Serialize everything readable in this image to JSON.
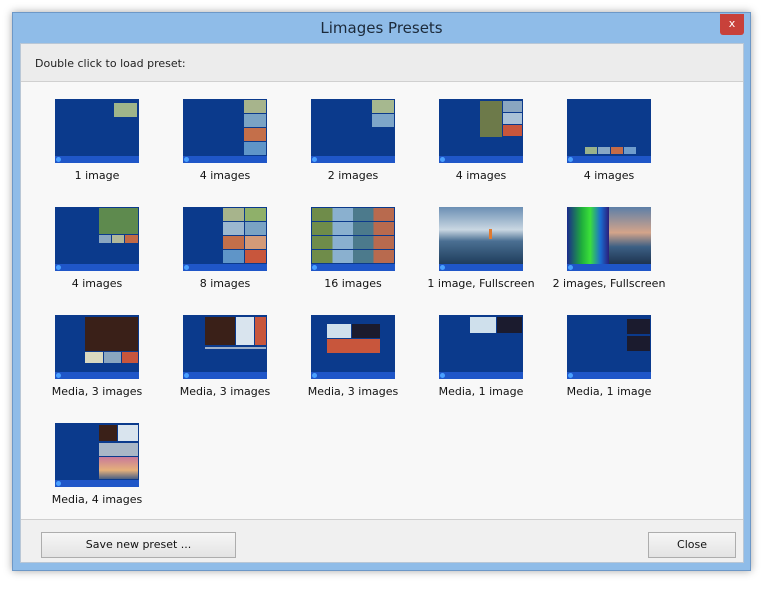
{
  "window": {
    "title": "Limages Presets",
    "close_glyph": "x"
  },
  "hint": {
    "text": "Double click to load preset:"
  },
  "presets": [
    {
      "label": "1 image"
    },
    {
      "label": "4 images"
    },
    {
      "label": "2 images"
    },
    {
      "label": "4 images"
    },
    {
      "label": "4 images"
    },
    {
      "label": "4 images"
    },
    {
      "label": "8 images"
    },
    {
      "label": "16 images"
    },
    {
      "label": "1 image, Fullscreen"
    },
    {
      "label": "2 images, Fullscreen"
    },
    {
      "label": "Media, 3 images"
    },
    {
      "label": "Media, 3 images"
    },
    {
      "label": "Media, 3 images"
    },
    {
      "label": "Media, 1 image"
    },
    {
      "label": "Media, 1 image"
    },
    {
      "label": "Media, 4 images"
    }
  ],
  "buttons": {
    "save_label": "Save new preset ...",
    "close_label": "Close"
  },
  "colors": {
    "title_bar": "#8fbce8",
    "thumb_background": "#0b3a8c",
    "close_red": "#c8413a"
  }
}
